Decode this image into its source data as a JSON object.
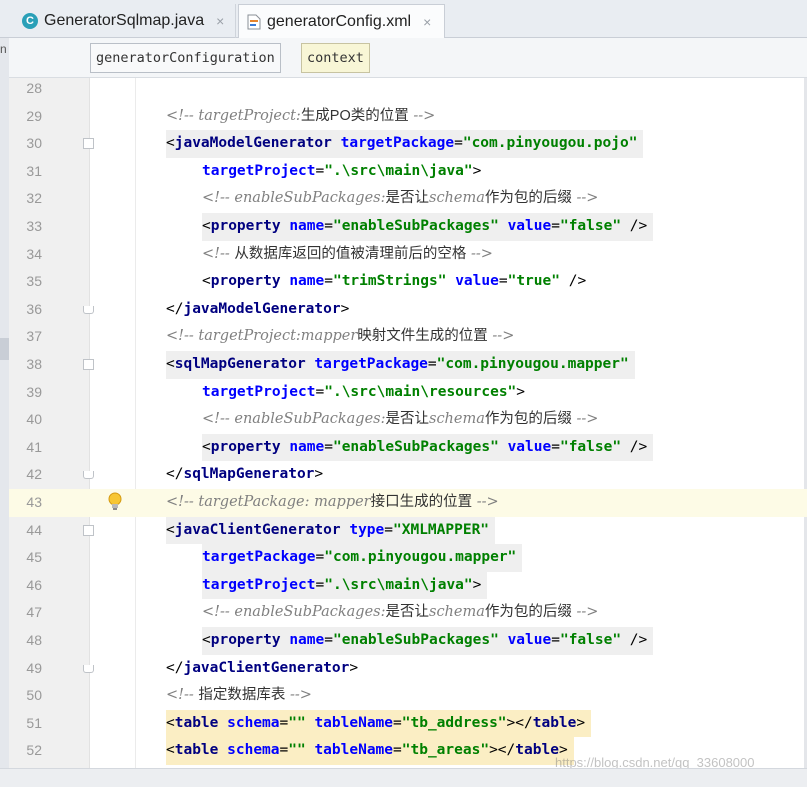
{
  "tabs": [
    {
      "label": "GeneratorSqlmap.java",
      "icon": "java-class-icon",
      "active": false
    },
    {
      "label": "generatorConfig.xml",
      "icon": "xml-file-icon",
      "active": true,
      "close": "×"
    }
  ],
  "left_strip": {
    "text": "n"
  },
  "breadcrumb": [
    "generatorConfiguration",
    "context"
  ],
  "editor": {
    "current_line": 43,
    "lines": [
      {
        "no": "28",
        "indent": 0,
        "kind": "blank"
      },
      {
        "no": "29",
        "indent": 1,
        "kind": "comment",
        "parts": [
          [
            "cm",
            "<!-- targetProject:"
          ],
          [
            "cmt",
            "生成PO类的位置"
          ],
          [
            "cm",
            " -->"
          ]
        ]
      },
      {
        "no": "30",
        "indent": 1,
        "kind": "code",
        "fold": "start",
        "hl": true,
        "parts": [
          [
            "br",
            "<"
          ],
          [
            "tag",
            "javaModelGenerator"
          ],
          [
            "br",
            " "
          ],
          [
            "att",
            "targetPackage"
          ],
          [
            "br",
            "="
          ],
          [
            "val",
            "\"com.pinyougou.pojo\""
          ]
        ]
      },
      {
        "no": "31",
        "indent": 2,
        "kind": "code",
        "parts": [
          [
            "att",
            "targetProject"
          ],
          [
            "br",
            "="
          ],
          [
            "val",
            "\".\\src\\main\\java\""
          ],
          [
            "br",
            ">"
          ]
        ]
      },
      {
        "no": "32",
        "indent": 2,
        "kind": "comment",
        "parts": [
          [
            "cm",
            "<!-- enableSubPackages:"
          ],
          [
            "cmt",
            "是否让"
          ],
          [
            "cm",
            "schema"
          ],
          [
            "cmt",
            "作为包的后缀"
          ],
          [
            "cm",
            " -->"
          ]
        ]
      },
      {
        "no": "33",
        "indent": 2,
        "kind": "code",
        "hl": true,
        "parts": [
          [
            "br",
            "<"
          ],
          [
            "tag",
            "property"
          ],
          [
            "br",
            " "
          ],
          [
            "att",
            "name"
          ],
          [
            "br",
            "="
          ],
          [
            "val",
            "\"enableSubPackages\""
          ],
          [
            "br",
            " "
          ],
          [
            "att",
            "value"
          ],
          [
            "br",
            "="
          ],
          [
            "val",
            "\"false\""
          ],
          [
            "br",
            " />"
          ]
        ]
      },
      {
        "no": "34",
        "indent": 2,
        "kind": "comment",
        "parts": [
          [
            "cm",
            "<!-- "
          ],
          [
            "cmt",
            "从数据库返回的值被清理前后的空格"
          ],
          [
            "cm",
            " -->"
          ]
        ]
      },
      {
        "no": "35",
        "indent": 2,
        "kind": "code",
        "parts": [
          [
            "br",
            "<"
          ],
          [
            "tag",
            "property"
          ],
          [
            "br",
            " "
          ],
          [
            "att",
            "name"
          ],
          [
            "br",
            "="
          ],
          [
            "val",
            "\"trimStrings\""
          ],
          [
            "br",
            " "
          ],
          [
            "att",
            "value"
          ],
          [
            "br",
            "="
          ],
          [
            "val",
            "\"true\""
          ],
          [
            "br",
            " />"
          ]
        ]
      },
      {
        "no": "36",
        "indent": 1,
        "kind": "code",
        "fold": "end",
        "parts": [
          [
            "br",
            "</"
          ],
          [
            "tag",
            "javaModelGenerator"
          ],
          [
            "br",
            ">"
          ]
        ]
      },
      {
        "no": "37",
        "indent": 1,
        "kind": "comment",
        "parts": [
          [
            "cm",
            "<!-- targetProject:mapper"
          ],
          [
            "cmt",
            "映射文件生成的位置"
          ],
          [
            "cm",
            " -->"
          ]
        ]
      },
      {
        "no": "38",
        "indent": 1,
        "kind": "code",
        "fold": "start",
        "hl": true,
        "parts": [
          [
            "br",
            "<"
          ],
          [
            "tag",
            "sqlMapGenerator"
          ],
          [
            "br",
            " "
          ],
          [
            "att",
            "targetPackage"
          ],
          [
            "br",
            "="
          ],
          [
            "val",
            "\"com.pinyougou.mapper\""
          ]
        ]
      },
      {
        "no": "39",
        "indent": 2,
        "kind": "code",
        "parts": [
          [
            "att",
            "targetProject"
          ],
          [
            "br",
            "="
          ],
          [
            "val",
            "\".\\src\\main\\resources\""
          ],
          [
            "br",
            ">"
          ]
        ]
      },
      {
        "no": "40",
        "indent": 2,
        "kind": "comment",
        "parts": [
          [
            "cm",
            "<!-- enableSubPackages:"
          ],
          [
            "cmt",
            "是否让"
          ],
          [
            "cm",
            "schema"
          ],
          [
            "cmt",
            "作为包的后缀"
          ],
          [
            "cm",
            " -->"
          ]
        ]
      },
      {
        "no": "41",
        "indent": 2,
        "kind": "code",
        "hl": true,
        "parts": [
          [
            "br",
            "<"
          ],
          [
            "tag",
            "property"
          ],
          [
            "br",
            " "
          ],
          [
            "att",
            "name"
          ],
          [
            "br",
            "="
          ],
          [
            "val",
            "\"enableSubPackages\""
          ],
          [
            "br",
            " "
          ],
          [
            "att",
            "value"
          ],
          [
            "br",
            "="
          ],
          [
            "val",
            "\"false\""
          ],
          [
            "br",
            " />"
          ]
        ]
      },
      {
        "no": "42",
        "indent": 1,
        "kind": "code",
        "fold": "end",
        "parts": [
          [
            "br",
            "</"
          ],
          [
            "tag",
            "sqlMapGenerator"
          ],
          [
            "br",
            ">"
          ]
        ]
      },
      {
        "no": "43",
        "indent": 1,
        "kind": "comment",
        "bulb": true,
        "parts": [
          [
            "cm",
            "<!-- targetPackage: mapper"
          ],
          [
            "cmt",
            "接口生成的位置"
          ],
          [
            "cm",
            " -->"
          ]
        ]
      },
      {
        "no": "44",
        "indent": 1,
        "kind": "code",
        "fold": "start",
        "hl": true,
        "parts": [
          [
            "br",
            "<"
          ],
          [
            "tag",
            "javaClientGenerator"
          ],
          [
            "br",
            " "
          ],
          [
            "att",
            "type"
          ],
          [
            "br",
            "="
          ],
          [
            "val",
            "\"XMLMAPPER\""
          ]
        ]
      },
      {
        "no": "45",
        "indent": 2,
        "kind": "code",
        "hl": true,
        "parts": [
          [
            "att",
            "targetPackage"
          ],
          [
            "br",
            "="
          ],
          [
            "val",
            "\"com.pinyougou.mapper\""
          ]
        ]
      },
      {
        "no": "46",
        "indent": 2,
        "kind": "code",
        "hl": true,
        "parts": [
          [
            "att",
            "targetProject"
          ],
          [
            "br",
            "="
          ],
          [
            "val",
            "\".\\src\\main\\java\""
          ],
          [
            "br",
            ">"
          ]
        ]
      },
      {
        "no": "47",
        "indent": 2,
        "kind": "comment",
        "parts": [
          [
            "cm",
            "<!-- enableSubPackages:"
          ],
          [
            "cmt",
            "是否让"
          ],
          [
            "cm",
            "schema"
          ],
          [
            "cmt",
            "作为包的后缀"
          ],
          [
            "cm",
            " -->"
          ]
        ]
      },
      {
        "no": "48",
        "indent": 2,
        "kind": "code",
        "hl": true,
        "parts": [
          [
            "br",
            "<"
          ],
          [
            "tag",
            "property"
          ],
          [
            "br",
            " "
          ],
          [
            "att",
            "name"
          ],
          [
            "br",
            "="
          ],
          [
            "val",
            "\"enableSubPackages\""
          ],
          [
            "br",
            " "
          ],
          [
            "att",
            "value"
          ],
          [
            "br",
            "="
          ],
          [
            "val",
            "\"false\""
          ],
          [
            "br",
            " />"
          ]
        ]
      },
      {
        "no": "49",
        "indent": 1,
        "kind": "code",
        "fold": "end",
        "parts": [
          [
            "br",
            "</"
          ],
          [
            "tag",
            "javaClientGenerator"
          ],
          [
            "br",
            ">"
          ]
        ]
      },
      {
        "no": "50",
        "indent": 1,
        "kind": "comment",
        "parts": [
          [
            "cm",
            "<!-- "
          ],
          [
            "cmt",
            "指定数据库表"
          ],
          [
            "cm",
            " -->"
          ]
        ]
      },
      {
        "no": "51",
        "indent": 1,
        "kind": "code",
        "hl2": true,
        "parts": [
          [
            "br",
            "<"
          ],
          [
            "tag",
            "table"
          ],
          [
            "br",
            " "
          ],
          [
            "att",
            "schema"
          ],
          [
            "br",
            "="
          ],
          [
            "val",
            "\"\""
          ],
          [
            "br",
            " "
          ],
          [
            "att",
            "tableName"
          ],
          [
            "br",
            "="
          ],
          [
            "val",
            "\"tb_address\""
          ],
          [
            "br",
            "></"
          ],
          [
            "tag",
            "table"
          ],
          [
            "br",
            ">"
          ]
        ]
      },
      {
        "no": "52",
        "indent": 1,
        "kind": "code",
        "hl2": true,
        "parts": [
          [
            "br",
            "<"
          ],
          [
            "tag",
            "table"
          ],
          [
            "br",
            " "
          ],
          [
            "att",
            "schema"
          ],
          [
            "br",
            "="
          ],
          [
            "val",
            "\"\""
          ],
          [
            "br",
            " "
          ],
          [
            "att",
            "tableName"
          ],
          [
            "br",
            "="
          ],
          [
            "val",
            "\"tb_areas\""
          ],
          [
            "br",
            "></"
          ],
          [
            "tag",
            "table"
          ],
          [
            "br",
            ">"
          ]
        ]
      }
    ]
  },
  "watermark": "https://blog.csdn.net/qq_33608000"
}
